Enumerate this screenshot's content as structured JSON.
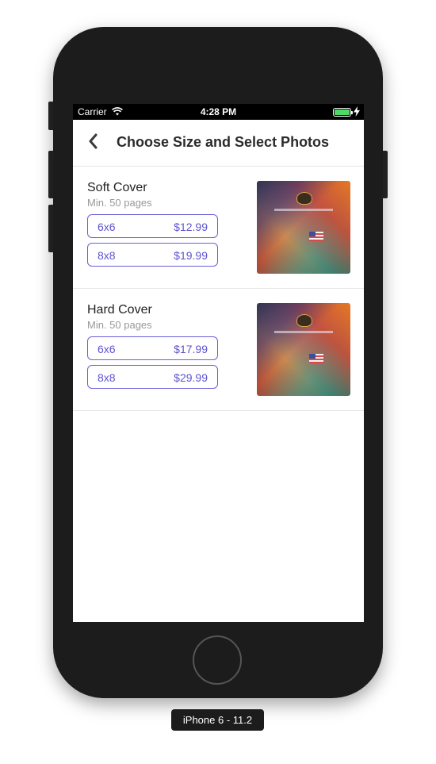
{
  "status_bar": {
    "carrier": "Carrier",
    "time": "4:28 PM",
    "battery_color": "#4cd964",
    "wifi_icon": "wifi-icon",
    "battery_icon": "battery-icon",
    "charging_icon": "bolt-icon"
  },
  "nav": {
    "back_icon": "chevron-left-icon",
    "title": "Choose Size and Select Photos"
  },
  "products": [
    {
      "name": "Soft Cover",
      "min_pages": "Min. 50 pages",
      "options": [
        {
          "size": "6x6",
          "price": "$12.99"
        },
        {
          "size": "8x8",
          "price": "$19.99"
        }
      ]
    },
    {
      "name": "Hard Cover",
      "min_pages": "Min. 50 pages",
      "options": [
        {
          "size": "6x6",
          "price": "$17.99"
        },
        {
          "size": "8x8",
          "price": "$29.99"
        }
      ]
    }
  ],
  "device_label": "iPhone 6 - 11.2",
  "colors": {
    "accent": "#5e54d1",
    "device_frame": "#1c1c1c"
  }
}
